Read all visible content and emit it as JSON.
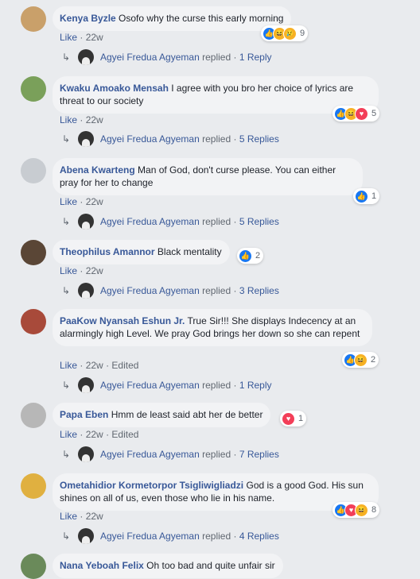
{
  "comments": [
    {
      "author": "Kenya Byzle",
      "text": "Osofo why the curse this early morning",
      "like": "Like",
      "time": "22w",
      "edited": "",
      "reaction_count": "9",
      "reply_user": "Agyei Fredua Agyeman",
      "replied": "replied",
      "reply_count": "1 Reply",
      "avatar_color": "#c9a06a"
    },
    {
      "author": "Kwaku Amoako Mensah",
      "text": "I agree with you bro her choice of lyrics are threat to our society",
      "like": "Like",
      "time": "22w",
      "edited": "",
      "reaction_count": "5",
      "reply_user": "Agyei Fredua Agyeman",
      "replied": "replied",
      "reply_count": "5 Replies",
      "avatar_color": "#7aa05a"
    },
    {
      "author": "Abena Kwarteng",
      "text": "Man of God, don't curse please. You can either pray for her to change",
      "like": "Like",
      "time": "22w",
      "edited": "",
      "reaction_count": "1",
      "reply_user": "Agyei Fredua Agyeman",
      "replied": "replied",
      "reply_count": "5 Replies",
      "avatar_color": "#c8ccd1"
    },
    {
      "author": "Theophilus Amannor",
      "text": "Black mentality",
      "like": "Like",
      "time": "22w",
      "edited": "",
      "reaction_count": "2",
      "reply_user": "Agyei Fredua Agyeman",
      "replied": "replied",
      "reply_count": "3 Replies",
      "avatar_color": "#5a4636"
    },
    {
      "author": "PaaKow Nyansah Eshun Jr.",
      "text": "True Sir!!! She displays Indecency at an alarmingly high Level. We pray God brings her down so she can repent",
      "like": "Like",
      "time": "22w",
      "edited": "Edited",
      "reaction_count": "2",
      "reply_user": "Agyei Fredua Agyeman",
      "replied": "replied",
      "reply_count": "1 Reply",
      "avatar_color": "#a84a3a"
    },
    {
      "author": "Papa Eben",
      "text": "Hmm de least said abt her de better",
      "like": "Like",
      "time": "22w",
      "edited": "Edited",
      "reaction_count": "1",
      "reply_user": "Agyei Fredua Agyeman",
      "replied": "replied",
      "reply_count": "7 Replies",
      "avatar_color": "#b7b7b7"
    },
    {
      "author": "Ometahidior Kormetorpor Tsigliwigliadzi",
      "text": "God is a good God. His sun shines on all of us, even those who lie in his name.",
      "like": "Like",
      "time": "22w",
      "edited": "",
      "reaction_count": "8",
      "reply_user": "Agyei Fredua Agyeman",
      "replied": "replied",
      "reply_count": "4 Replies",
      "avatar_color": "#e0b040"
    },
    {
      "author": "Nana Yeboah Felix",
      "text": "Oh too bad and quite unfair sir",
      "like": "",
      "time": "",
      "edited": "",
      "reaction_count": "",
      "reply_user": "",
      "replied": "",
      "reply_count": "",
      "avatar_color": "#6a8a5a"
    }
  ],
  "icons": {
    "reply_arrow": "reply-arrow-icon",
    "like": "like-reaction-icon",
    "haha": "haha-reaction-icon",
    "sad": "sad-reaction-icon",
    "love": "love-reaction-icon"
  },
  "separator": "·",
  "colors": {
    "link": "#385898",
    "bubble": "#f2f3f5",
    "background": "#e9ebee",
    "like_blue": "#1877f2",
    "love_red": "#f33e58"
  }
}
